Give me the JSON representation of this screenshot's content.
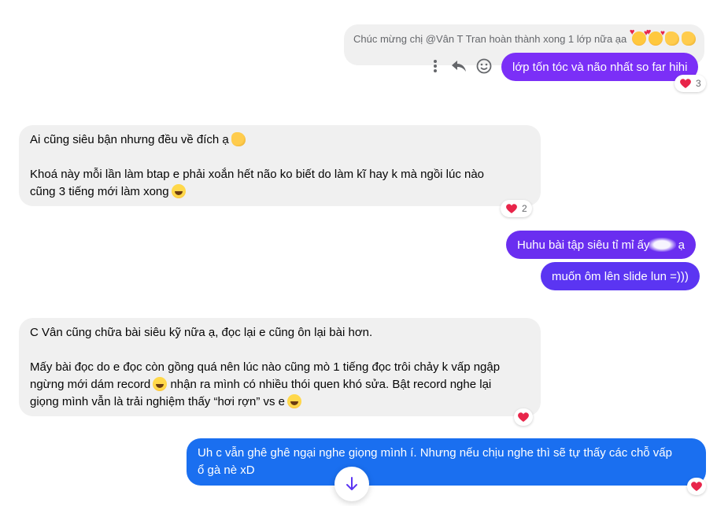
{
  "colors": {
    "outgoing_purple": "#7b2ff7",
    "outgoing_purple_2": "#6a2ef0",
    "outgoing_blue": "#1a6ff0",
    "incoming_bg": "#f0f0f0",
    "heart": "#e8254a"
  },
  "reply_preview": {
    "text": "Chúc mừng chị @Vân T Tran hoàn thành xong 1 lớp nữa ạa",
    "emojis": [
      "heart-eyes-icon",
      "heart-eyes-icon",
      "clap-icon",
      "clap-icon"
    ]
  },
  "message_actions": {
    "more_icon": "more-vertical-icon",
    "reply_icon": "reply-icon",
    "react_icon": "smiley-icon"
  },
  "messages": [
    {
      "direction": "outgoing",
      "lines": [
        "lớp tốn tóc và não nhất so far hihi"
      ],
      "reaction": {
        "icon": "heart-icon",
        "count": "3"
      }
    },
    {
      "direction": "incoming",
      "lines": [
        "Ai cũng siêu bận nhưng đều về đích ạ",
        "",
        "Khoá này mỗi lần làm btap e phải xoắn hết não ko biết do làm kĩ hay k mà ngồi lúc nào",
        "cũng 3 tiếng mới làm xong"
      ],
      "reaction": {
        "icon": "heart-icon",
        "count": "2"
      }
    },
    {
      "direction": "outgoing",
      "lines": [
        "Huhu bài tập siêu tỉ mỉ ấy",
        "ạ"
      ]
    },
    {
      "direction": "outgoing",
      "lines": [
        "muốn ôm lên slide lun =)))"
      ]
    },
    {
      "direction": "incoming",
      "lines": [
        "C Vân cũng chữa bài siêu kỹ nữa ạ, đọc lại e cũng ôn lại bài hơn.",
        "",
        "Mấy bài đọc do e đọc còn gồng quá nên lúc nào cũng mò 1 tiếng đọc trôi chảy k vấp ngập",
        "ngừng mới dám record",
        "nhận ra mình có nhiều thói quen khó sửa. Bật record nghe lại",
        "giọng mình vẫn là trải nghiệm thấy “hơi rợn” vs e"
      ],
      "reaction": {
        "icon": "heart-icon",
        "count": ""
      }
    },
    {
      "direction": "outgoing",
      "lines": [
        "Uh c vẫn ghê ghê ngại nghe giọng mình í. Nhưng nếu chịu nghe thì sẽ tự thấy các chỗ vấp",
        "ổ gà nè xD"
      ],
      "reaction": {
        "icon": "heart-icon",
        "count": ""
      }
    }
  ],
  "scroll_button": {
    "icon": "arrow-down-icon"
  }
}
